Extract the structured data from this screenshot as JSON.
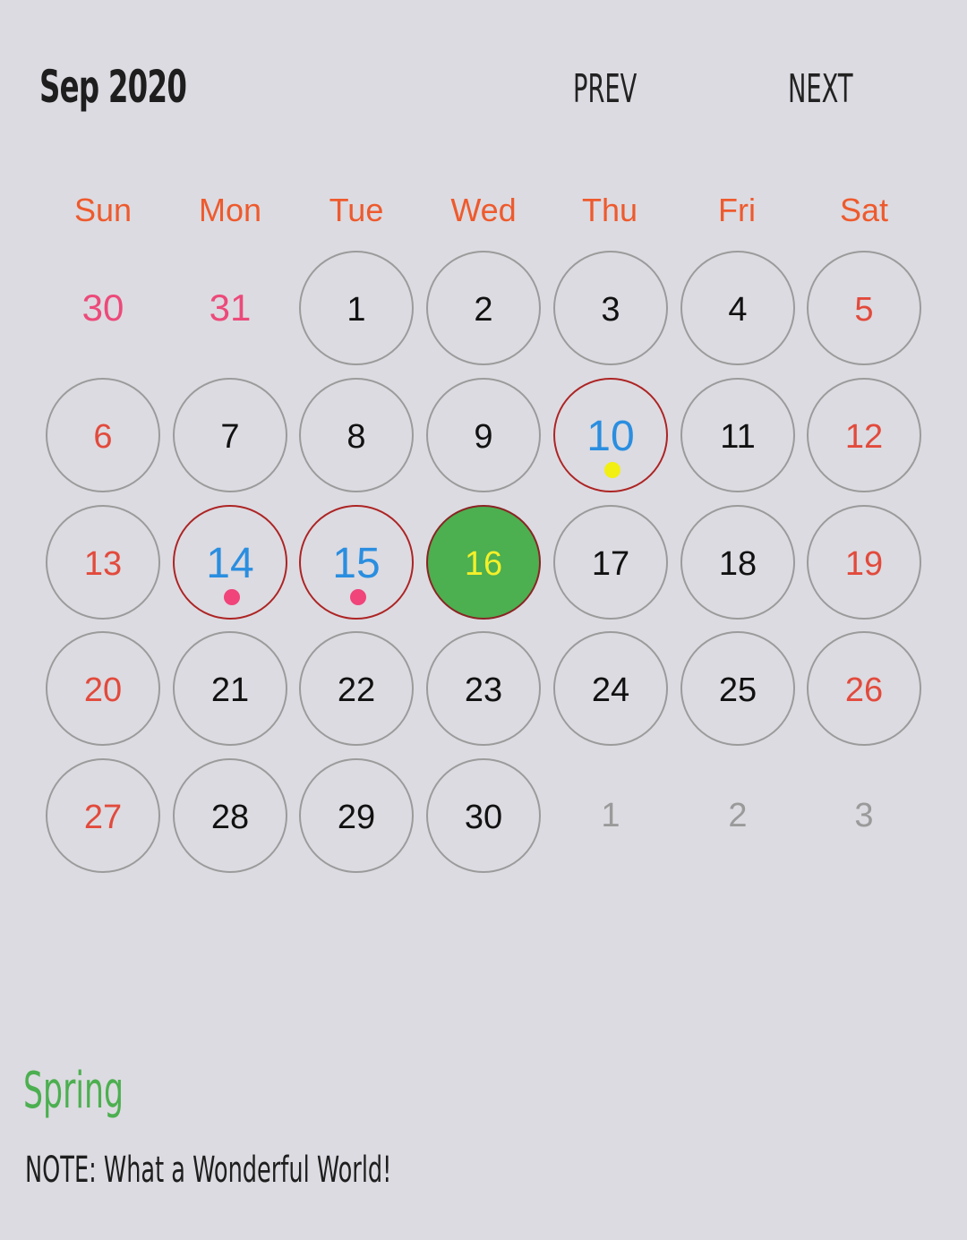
{
  "header": {
    "month_title": "Sep 2020",
    "prev_label": "PREV",
    "next_label": "NEXT"
  },
  "weekdays": [
    "Sun",
    "Mon",
    "Tue",
    "Wed",
    "Thu",
    "Fri",
    "Sat"
  ],
  "colors": {
    "weekday": "#ee5a2d",
    "today_fill": "#4caf50",
    "today_text": "#f4f02a",
    "event_text": "#2a8ee0",
    "event_ring": "#ad2424",
    "weekend_text": "#e24a3c",
    "prev_month_text": "#ec4a7a",
    "next_month_text": "#9a9a9a",
    "season_text": "#4caf50"
  },
  "weeks": [
    [
      {
        "label": "30",
        "type": "prevmonth"
      },
      {
        "label": "31",
        "type": "prevmonth"
      },
      {
        "label": "1",
        "type": "normal"
      },
      {
        "label": "2",
        "type": "normal"
      },
      {
        "label": "3",
        "type": "normal"
      },
      {
        "label": "4",
        "type": "normal"
      },
      {
        "label": "5",
        "type": "weekend"
      }
    ],
    [
      {
        "label": "6",
        "type": "weekend"
      },
      {
        "label": "7",
        "type": "normal"
      },
      {
        "label": "8",
        "type": "normal"
      },
      {
        "label": "9",
        "type": "normal"
      },
      {
        "label": "10",
        "type": "event",
        "dot": "#f2ef12"
      },
      {
        "label": "11",
        "type": "normal"
      },
      {
        "label": "12",
        "type": "weekend"
      }
    ],
    [
      {
        "label": "13",
        "type": "weekend"
      },
      {
        "label": "14",
        "type": "event",
        "dot": "#f0447a"
      },
      {
        "label": "15",
        "type": "event",
        "dot": "#f0447a"
      },
      {
        "label": "16",
        "type": "today"
      },
      {
        "label": "17",
        "type": "normal"
      },
      {
        "label": "18",
        "type": "normal"
      },
      {
        "label": "19",
        "type": "weekend"
      }
    ],
    [
      {
        "label": "20",
        "type": "weekend"
      },
      {
        "label": "21",
        "type": "normal"
      },
      {
        "label": "22",
        "type": "normal"
      },
      {
        "label": "23",
        "type": "normal"
      },
      {
        "label": "24",
        "type": "normal"
      },
      {
        "label": "25",
        "type": "normal"
      },
      {
        "label": "26",
        "type": "weekend"
      }
    ],
    [
      {
        "label": "27",
        "type": "weekend"
      },
      {
        "label": "28",
        "type": "normal"
      },
      {
        "label": "29",
        "type": "normal"
      },
      {
        "label": "30",
        "type": "normal"
      },
      {
        "label": "1",
        "type": "nextmonth"
      },
      {
        "label": "2",
        "type": "nextmonth"
      },
      {
        "label": "3",
        "type": "nextmonth"
      }
    ]
  ],
  "footer": {
    "season": "Spring",
    "note": "NOTE: What a Wonderful World!"
  }
}
